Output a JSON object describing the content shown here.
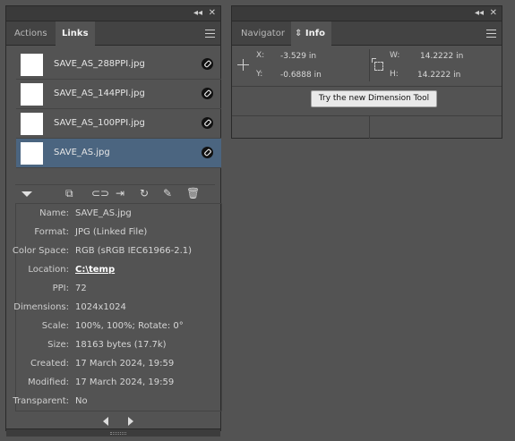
{
  "links_panel": {
    "tabs": [
      "Actions",
      "Links"
    ],
    "active_tab": "Links",
    "items": [
      {
        "name": "SAVE_AS_288PPI.jpg",
        "selected": false
      },
      {
        "name": "SAVE_AS_144PPI.jpg",
        "selected": false
      },
      {
        "name": "SAVE_AS_100PPI.jpg",
        "selected": false
      },
      {
        "name": "SAVE_AS.jpg",
        "selected": true
      }
    ],
    "details": [
      {
        "key": "Name:",
        "value": "SAVE_AS.jpg"
      },
      {
        "key": "Format:",
        "value": "JPG (Linked File)"
      },
      {
        "key": "Color Space:",
        "value": "RGB (sRGB IEC61966-2.1)"
      },
      {
        "key": "Location:",
        "value": "C:\\temp"
      },
      {
        "key": "PPI:",
        "value": "72"
      },
      {
        "key": "Dimensions:",
        "value": "1024x1024"
      },
      {
        "key": "Scale:",
        "value": "100%, 100%; Rotate: 0°"
      },
      {
        "key": "Size:",
        "value": "18163 bytes (17.7k)"
      },
      {
        "key": "Created:",
        "value": "17 March 2024, 19:59"
      },
      {
        "key": "Modified:",
        "value": "17 March 2024, 19:59"
      },
      {
        "key": "Transparent:",
        "value": "No"
      }
    ],
    "dock_controls": {
      "collapse": "◂◂",
      "close": "✕"
    }
  },
  "info_panel": {
    "tabs": [
      "Navigator",
      "Info"
    ],
    "active_tab": "Info",
    "x_label": "X:",
    "x_value": "-3.529 in",
    "y_label": "Y:",
    "y_value": "-0.6888 in",
    "w_label": "W:",
    "w_value": "14.2222 in",
    "h_label": "H:",
    "h_value": "14.2222 in",
    "try_button": "Try the new Dimension Tool",
    "dock_controls": {
      "collapse": "◂◂",
      "close": "✕"
    }
  },
  "colors": {
    "background": "#535353",
    "selection": "#4b6580"
  }
}
